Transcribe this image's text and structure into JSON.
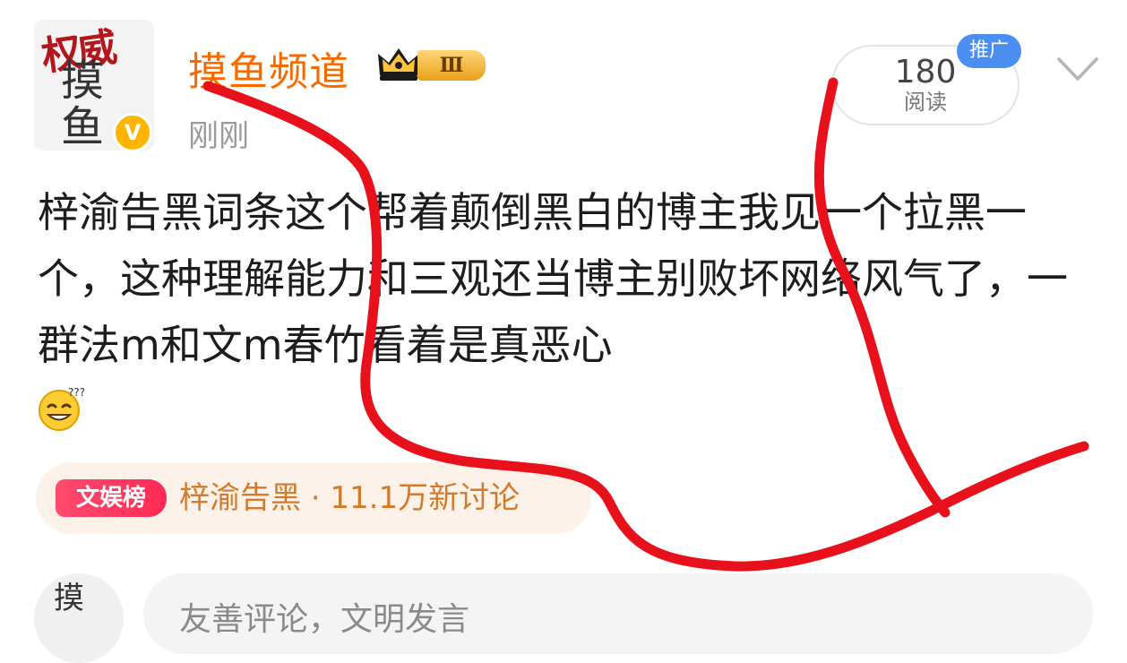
{
  "post": {
    "author": {
      "name": "摸鱼频道",
      "level_badge": "Ⅲ",
      "avatar_seal": "权威",
      "avatar_ink": "摸 鱼",
      "verified_mark": "V"
    },
    "time": "刚刚",
    "reads": {
      "count": "180",
      "label": "阅读"
    },
    "promoted_badge": "推广",
    "text": "梓渝告黑词条这个帮着颠倒黑白的博主我见一个拉黑一个，这种理解能力和三观还当博主别败坏网络风气了，一群法m和文m春竹看着是真恶心",
    "topic": {
      "tag": "文娱榜",
      "text": "梓渝告黑 · 11.1万新讨论"
    }
  },
  "comment": {
    "avatar_text": "摸",
    "placeholder": "友善评论，文明发言"
  },
  "colors": {
    "author_orange": "#f76a00",
    "scribble_red": "#e8101a",
    "promo_blue": "#4a8ef2",
    "topic_bg": "#fdf2ea"
  },
  "icons": [
    "crown-icon",
    "verified-icon",
    "chevron-down-icon",
    "emoji-icon"
  ]
}
